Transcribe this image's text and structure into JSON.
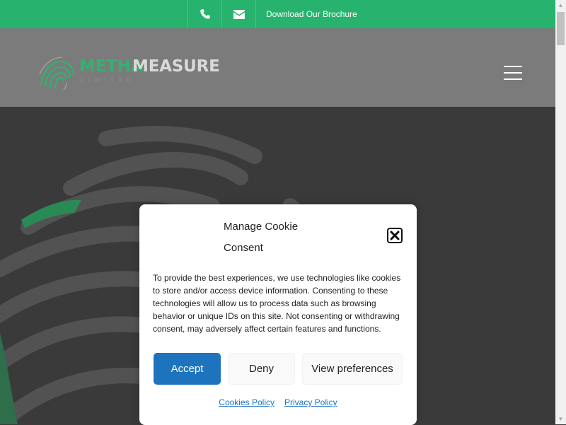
{
  "topbar": {
    "phone_icon": "phone-icon",
    "email_icon": "envelope-icon",
    "brochure_label": "Download Our Brochure",
    "bg_color": "#27b36d"
  },
  "header": {
    "logo": {
      "word_part1": "METHA",
      "word_part2": "MEASURE",
      "sub": "LIMITED",
      "brand_green": "#2fb36e"
    },
    "menu_icon": "hamburger-menu-icon"
  },
  "cookie_modal": {
    "title_line1": "Manage Cookie",
    "title_line2": "Consent",
    "close_icon": "close-icon",
    "body": "To provide the best experiences, we use technologies like cookies to store and/or access device information. Consenting to these technologies will allow us to process data such as browsing behavior or unique IDs on this site. Not consenting or withdrawing consent, may adversely affect certain features and functions.",
    "accept_label": "Accept",
    "deny_label": "Deny",
    "preferences_label": "View preferences",
    "cookies_policy_label": "Cookies Policy",
    "privacy_policy_label": "Privacy Policy",
    "accent_color": "#1e73be"
  }
}
